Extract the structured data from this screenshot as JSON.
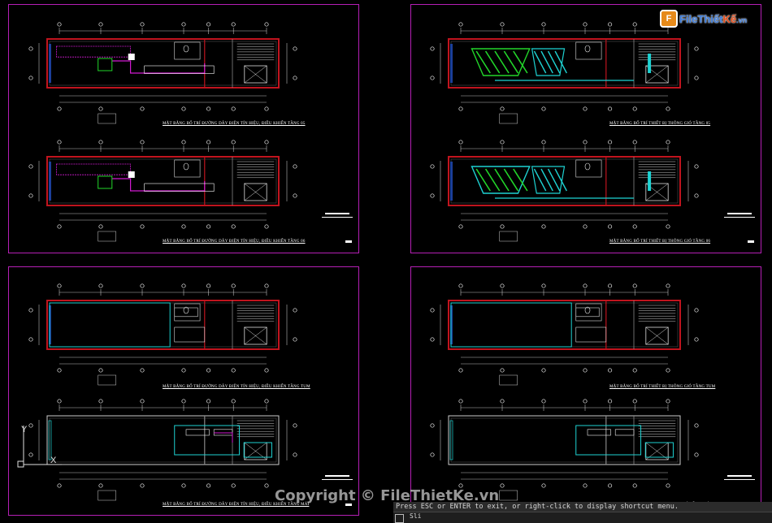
{
  "app": {
    "name": "AutoCAD drawing viewport"
  },
  "sheets": [
    {
      "plan_a_title": "MẶT BẰNG BỐ TRÍ ĐƯỜNG DÂY ĐIỆN TÍN HIỆU, ĐIỀU KHIỂN TẦNG 05",
      "plan_b_title": "MẶT BẰNG BỐ TRÍ ĐƯỜNG DÂY ĐIỆN TÍN HIỆU, ĐIỀU KHIỂN TẦNG 06"
    },
    {
      "plan_a_title": "MẶT BẰNG BỐ TRÍ THIẾT BỊ THÔNG GIÓ TẦNG 05",
      "plan_b_title": "MẶT BẰNG BỐ TRÍ THIẾT BỊ THÔNG GIÓ TẦNG 06"
    },
    {
      "plan_a_title": "MẶT BẰNG BỐ TRÍ ĐƯỜNG DÂY ĐIỆN TÍN HIỆU, ĐIỀU KHIỂN TẦNG TUM",
      "plan_b_title": "MẶT BẰNG BỐ TRÍ ĐƯỜNG DÂY ĐIỆN TÍN HIỆU, ĐIỀU KHIỂN TẦNG MÁI"
    },
    {
      "plan_a_title": "MẶT BẰNG BỐ TRÍ THIẾT BỊ THÔNG GIÓ TẦNG TUM",
      "plan_b_title": "GIÓ TẦNG MÁI"
    }
  ],
  "logo": {
    "brand_text": "FileThiết",
    "brand_accent": "Kế",
    "suffix": ".vn",
    "mark": "F"
  },
  "watermark": "Copyright © FileThietKe.vn",
  "command_line": {
    "prompt": "Press ESC or ENTER to exit, or right-click to display shortcut menu.",
    "input": "Sli"
  },
  "ucs": {
    "x_label": "X",
    "y_label": "Y"
  },
  "colors": {
    "sheet_border": "#b51fb5",
    "wall": "#c0141e",
    "cyan": "#1ed2d2",
    "green": "#22d62a",
    "magenta": "#d11ad1"
  }
}
